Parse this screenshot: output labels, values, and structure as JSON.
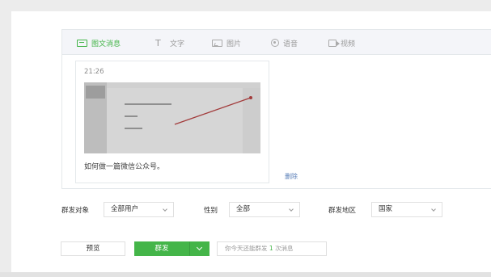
{
  "tabs": [
    {
      "label": "图文消息",
      "icon": "news-icon",
      "active": true
    },
    {
      "label": "文字",
      "icon": "text-icon",
      "active": false
    },
    {
      "label": "图片",
      "icon": "image-icon",
      "active": false
    },
    {
      "label": "语音",
      "icon": "voice-icon",
      "active": false
    },
    {
      "label": "视频",
      "icon": "video-icon",
      "active": false
    }
  ],
  "card": {
    "time": "21:26",
    "title": "如何做一篇微信公众号。"
  },
  "delete_label": "删除",
  "filters": {
    "target_label": "群发对象",
    "target_value": "全部用户",
    "gender_label": "性别",
    "gender_value": "全部",
    "region_label": "群发地区",
    "region_value": "国家"
  },
  "actions": {
    "preview_label": "预览",
    "send_label": "群发",
    "quota_prefix": "你今天还能群发",
    "quota_count": "1",
    "quota_suffix": "次消息"
  },
  "colors": {
    "accent": "#44b549",
    "link": "#5a7fb8"
  }
}
